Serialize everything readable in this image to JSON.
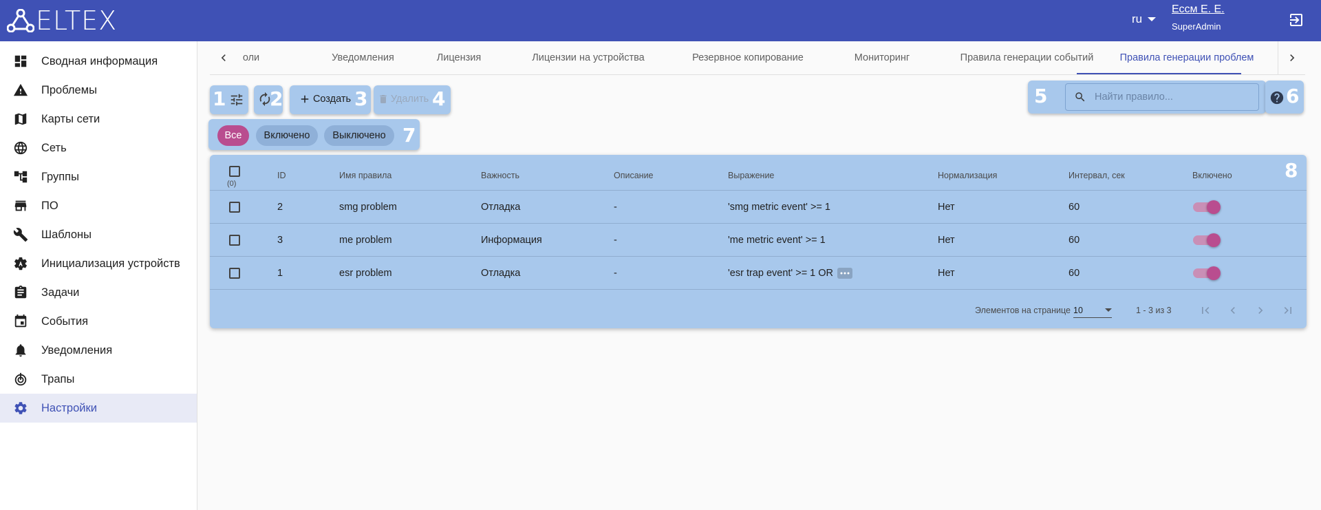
{
  "header": {
    "logo": "ELTEX",
    "lang": "ru",
    "user_name": "Ессм Е. Е.",
    "user_role": "SuperAdmin"
  },
  "sidebar": {
    "items": [
      {
        "label": "Сводная информация",
        "icon": "dashboard-icon"
      },
      {
        "label": "Проблемы",
        "icon": "warning-icon"
      },
      {
        "label": "Карты сети",
        "icon": "map-icon"
      },
      {
        "label": "Сеть",
        "icon": "globe-icon"
      },
      {
        "label": "Группы",
        "icon": "hierarchy-icon"
      },
      {
        "label": "ПО",
        "icon": "store-icon"
      },
      {
        "label": "Шаблоны",
        "icon": "wrench-icon"
      },
      {
        "label": "Инициализация устройств",
        "icon": "settings-a-icon"
      },
      {
        "label": "Задачи",
        "icon": "clipboard-icon"
      },
      {
        "label": "События",
        "icon": "calendar-icon"
      },
      {
        "label": "Уведомления",
        "icon": "bell-icon"
      },
      {
        "label": "Трапы",
        "icon": "trap-icon"
      },
      {
        "label": "Настройки",
        "icon": "gear-icon"
      }
    ],
    "active_index": 12
  },
  "tabs": [
    {
      "label": "оли"
    },
    {
      "label": "Уведомления"
    },
    {
      "label": "Лицензия"
    },
    {
      "label": "Лицензии на устройства"
    },
    {
      "label": "Резервное копирование"
    },
    {
      "label": "Мониторинг"
    },
    {
      "label": "Правила генерации событий"
    },
    {
      "label": "Правила генерации проблем"
    }
  ],
  "toolbar": {
    "create_label": "Создать",
    "delete_label": "Удалить",
    "search_placeholder": "Найти правило..."
  },
  "callouts": [
    "1",
    "2",
    "3",
    "4",
    "5",
    "6",
    "7",
    "8"
  ],
  "filters": [
    "Все",
    "Включено",
    "Выключено"
  ],
  "table": {
    "selected_count": "(0)",
    "columns": [
      "ID",
      "Имя правила",
      "Важность",
      "Описание",
      "Выражение",
      "Нормализация",
      "Интервал, сек",
      "Включено"
    ],
    "rows": [
      {
        "id": "2",
        "name": "smg problem",
        "severity": "Отладка",
        "description": "-",
        "expression": "'smg metric event' >= 1",
        "normalization": "Нет",
        "interval": "60",
        "enabled": true
      },
      {
        "id": "3",
        "name": "me problem",
        "severity": "Информация",
        "description": "-",
        "expression": "'me metric event' >= 1",
        "normalization": "Нет",
        "interval": "60",
        "enabled": true
      },
      {
        "id": "1",
        "name": "esr problem",
        "severity": "Отладка",
        "description": "-",
        "expression": "'esr trap event' >= 1 OR",
        "normalization": "Нет",
        "interval": "60",
        "enabled": true
      }
    ]
  },
  "pager": {
    "per_page_label": "Элементов на странице",
    "per_page_value": "10",
    "range": "1 - 3 из 3"
  },
  "colors": {
    "header": "#3f51b5",
    "accent": "#b94d8f",
    "highlight": "#a8c8ec"
  }
}
